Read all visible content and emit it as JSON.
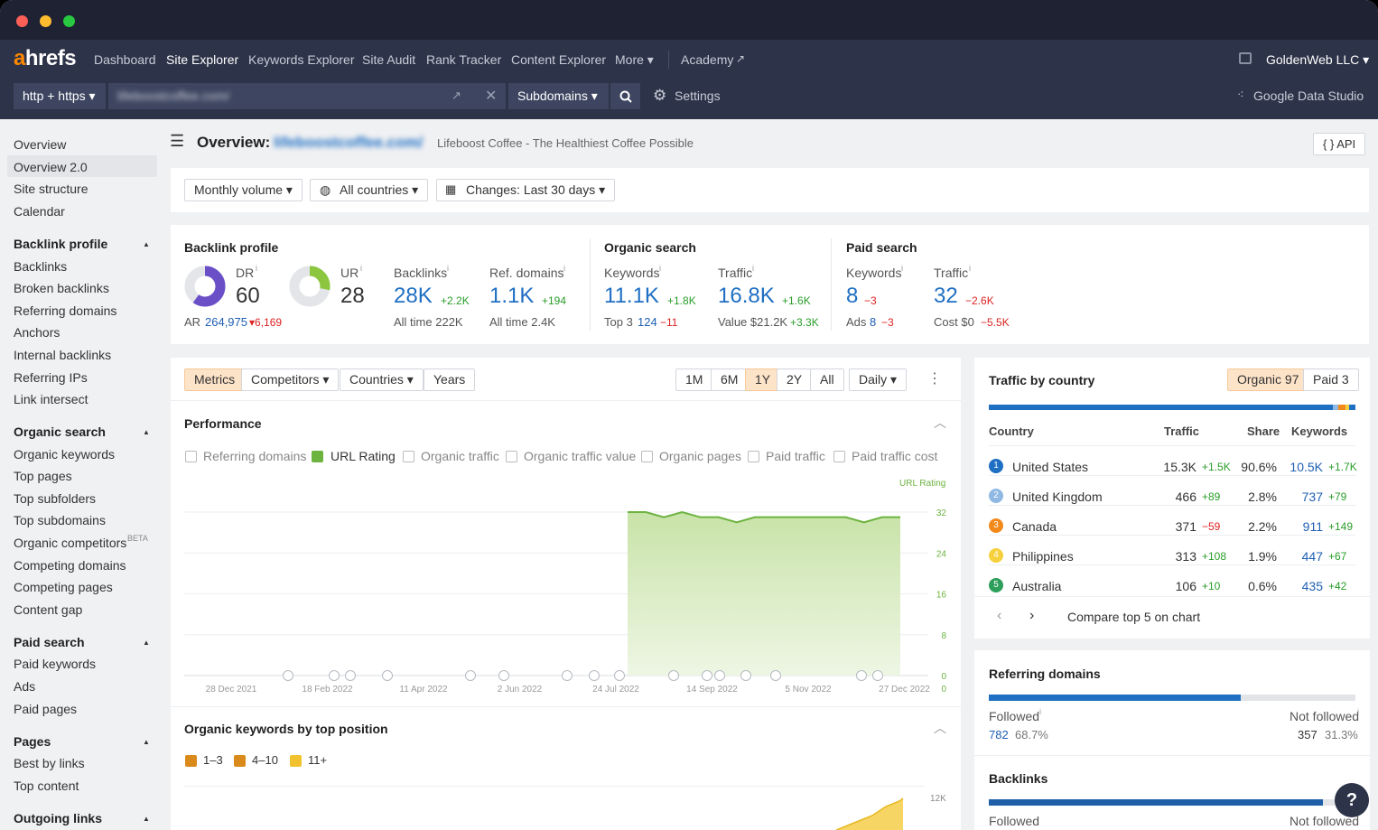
{
  "nav": {
    "logo_a": "a",
    "logo_rest": "hrefs",
    "items": [
      "Dashboard",
      "Site Explorer",
      "Keywords Explorer",
      "Site Audit",
      "Rank Tracker",
      "Content Explorer",
      "More ▾"
    ],
    "academy": "Academy",
    "account": "GoldenWeb LLC ▾"
  },
  "searchbar": {
    "protocol": "http + https ▾",
    "url": "lifeboostcoffee.com/",
    "mode": "Subdomains ▾",
    "settings": "Settings",
    "gds": "Google Data Studio"
  },
  "sidebar": {
    "top": [
      "Overview",
      "Overview 2.0",
      "Site structure",
      "Calendar"
    ],
    "backlink_head": "Backlink profile",
    "backlink": [
      "Backlinks",
      "Broken backlinks",
      "Referring domains",
      "Anchors",
      "Internal backlinks",
      "Referring IPs",
      "Link intersect"
    ],
    "organic_head": "Organic search",
    "organic": [
      "Organic keywords",
      "Top pages",
      "Top subfolders",
      "Top subdomains",
      "Organic competitors",
      "Competing domains",
      "Competing pages",
      "Content gap"
    ],
    "beta": "BETA",
    "paid_head": "Paid search",
    "paid": [
      "Paid keywords",
      "Ads",
      "Paid pages"
    ],
    "pages_head": "Pages",
    "pages": [
      "Best by links",
      "Top content"
    ],
    "outgoing_head": "Outgoing links"
  },
  "header": {
    "title": "Overview:",
    "domain": "lifeboostcoffee.com/",
    "subtitle": "Lifeboost Coffee - The Healthiest Coffee Possible",
    "api": "{ } API"
  },
  "filters": {
    "volume": "Monthly volume ▾",
    "countries": "All countries ▾",
    "changes": "Changes: Last 30 days ▾"
  },
  "backlink_profile": {
    "title": "Backlink profile",
    "dr_label": "DR",
    "dr": "60",
    "dr_fill": 0.6,
    "ar_label": "AR",
    "ar": "264,975",
    "ar_delta": "▾6,169",
    "ur_label": "UR",
    "ur": "28",
    "ur_fill": 0.28,
    "backlinks_label": "Backlinks",
    "backlinks": "28K",
    "backlinks_delta": "+2.2K",
    "backlinks_all": "All time  222K",
    "ref_label": "Ref. domains",
    "ref": "1.1K",
    "ref_delta": "+194",
    "ref_all": "All time  2.4K"
  },
  "organic_search": {
    "title": "Organic search",
    "kw_label": "Keywords",
    "kw": "11.1K",
    "kw_delta": "+1.8K",
    "top3_label": "Top 3",
    "top3": "124",
    "top3_delta": "−11",
    "traffic_label": "Traffic",
    "traffic": "16.8K",
    "traffic_delta": "+1.6K",
    "value_label": "Value  $21.2K",
    "value_delta": "+3.3K"
  },
  "paid_search": {
    "title": "Paid search",
    "kw_label": "Keywords",
    "kw": "8",
    "kw_delta": "−3",
    "ads_label": "Ads",
    "ads": "8",
    "ads_delta": "−3",
    "traffic_label": "Traffic",
    "traffic": "32",
    "traffic_delta": "−2.6K",
    "cost_label": "Cost  $0",
    "cost_delta": "−5.5K"
  },
  "tabs": {
    "metrics": "Metrics",
    "competitors": "Competitors ▾",
    "countries": "Countries ▾",
    "years": "Years",
    "ranges": [
      "1M",
      "6M",
      "1Y",
      "2Y",
      "All"
    ],
    "interval": "Daily ▾"
  },
  "performance": {
    "title": "Performance",
    "checks": [
      "Referring domains",
      "URL Rating",
      "Organic traffic",
      "Organic traffic value",
      "Organic pages",
      "Paid traffic",
      "Paid traffic cost"
    ],
    "series_label": "URL Rating"
  },
  "chart_data": {
    "type": "area",
    "series": [
      {
        "name": "URL Rating",
        "values": [
          32,
          32,
          31,
          32,
          31,
          31,
          30,
          31,
          31,
          31,
          31,
          31,
          31,
          30,
          31,
          31
        ]
      }
    ],
    "x_labels": [
      "28 Dec 2021",
      "18 Feb 2022",
      "11 Apr 2022",
      "2 Jun 2022",
      "24 Jul 2022",
      "14 Sep 2022",
      "5 Nov 2022",
      "27 Dec 2022"
    ],
    "y_ticks": [
      "32",
      "24",
      "16",
      "8",
      "0"
    ],
    "ylim": [
      0,
      32
    ],
    "grid": true
  },
  "okw": {
    "title": "Organic keywords by top position",
    "checks": [
      "1–3",
      "4–10",
      "11+"
    ],
    "y_tick": "12K"
  },
  "tbc": {
    "title": "Traffic by country",
    "organic": "Organic 97",
    "paid": "Paid 3",
    "cols": [
      "Country",
      "Traffic",
      "Share",
      "Keywords"
    ],
    "rows": [
      {
        "n": "1",
        "c": "United States",
        "t": "15.3K",
        "td": "+1.5K",
        "s": "90.6%",
        "k": "10.5K",
        "kd": "+1.7K",
        "col": "#1f6fc3"
      },
      {
        "n": "2",
        "c": "United Kingdom",
        "t": "466",
        "td": "+89",
        "s": "2.8%",
        "k": "737",
        "kd": "+79",
        "col": "#8fb9e3"
      },
      {
        "n": "3",
        "c": "Canada",
        "t": "371",
        "td": "−59",
        "s": "2.2%",
        "k": "911",
        "kd": "+149",
        "col": "#f2891b"
      },
      {
        "n": "4",
        "c": "Philippines",
        "t": "313",
        "td": "+108",
        "s": "1.9%",
        "k": "447",
        "kd": "+67",
        "col": "#f6d03d"
      },
      {
        "n": "5",
        "c": "Australia",
        "t": "106",
        "td": "+10",
        "s": "0.6%",
        "k": "435",
        "kd": "+42",
        "col": "#2e9e5b"
      }
    ],
    "compare": "Compare top 5 on chart"
  },
  "refdom": {
    "title": "Referring domains",
    "followed": "Followed",
    "followed_n": "782",
    "followed_p": "68.7%",
    "not": "Not followed",
    "not_n": "357",
    "not_p": "31.3%"
  },
  "backlinks_card": {
    "title": "Backlinks",
    "followed": "Followed",
    "not": "Not followed"
  }
}
